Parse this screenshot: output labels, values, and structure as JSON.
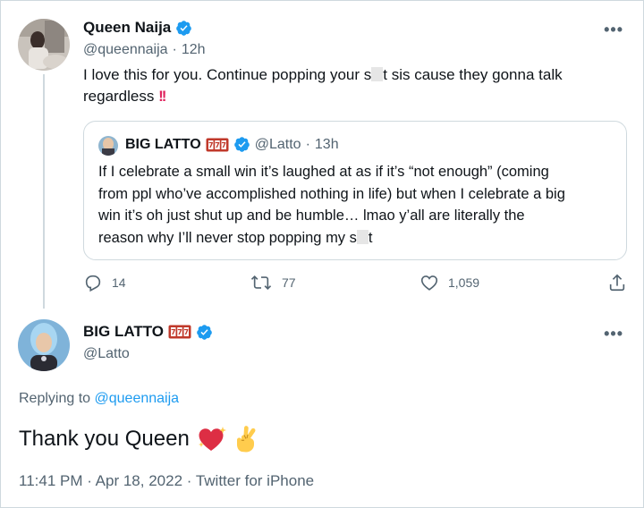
{
  "quoted_tweet_author": {
    "name": "Queen Naija",
    "handle": "@queennaija",
    "time": "12h",
    "text_part1": "I love this for you. Continue popping your s",
    "text_part2": "t sis cause they gonna talk",
    "text_line2": "regardless",
    "emoji": "‼️"
  },
  "quote": {
    "name": "BIG LATTO",
    "handle": "@Latto",
    "time": "13h",
    "lines": [
      "If I celebrate a small win it’s laughed at as if it’s “not enough” (coming",
      "from ppl who’ve accomplished nothing in life) but when I celebrate a big",
      "win it’s oh just shut up and be humble… lmao y’all are literally the",
      "reason why I’ll never stop popping my s"
    ],
    "line4_end": "t"
  },
  "actions": {
    "replies": "14",
    "retweets": "77",
    "likes": "1,059"
  },
  "reply": {
    "name": "BIG LATTO",
    "handle": "@Latto",
    "replying_prefix": "Replying to",
    "replying_to": "@queennaija",
    "text": "Thank you Queen",
    "timestamp": "11:41 PM · Apr 18, 2022 · Twitter for iPhone"
  },
  "colors": {
    "accent": "#1d9bf0",
    "secondary_text": "#536471",
    "border": "#cfd9de"
  },
  "icons": [
    "verified-badge-icon",
    "more-icon",
    "reply-icon",
    "retweet-icon",
    "like-icon",
    "share-icon",
    "slot-machine-emoji",
    "sparkling-heart-emoji",
    "crossed-fingers-emoji"
  ]
}
